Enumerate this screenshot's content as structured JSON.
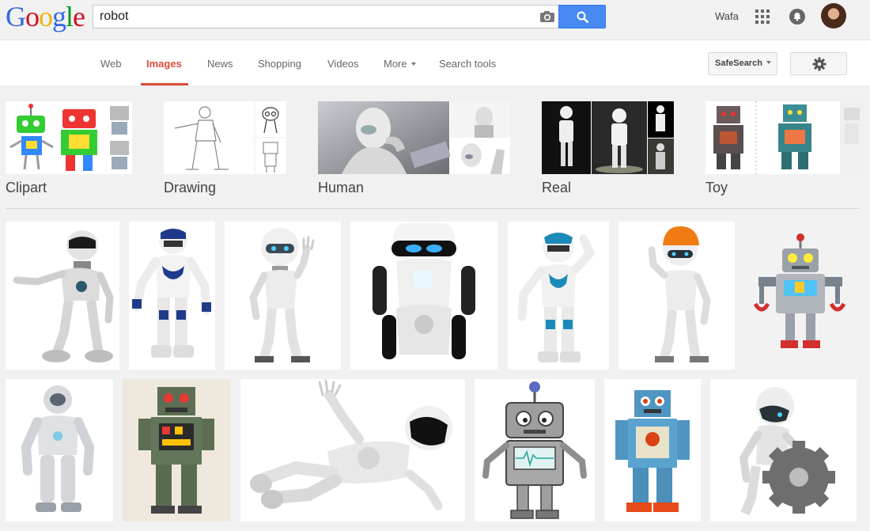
{
  "logo": {
    "letters": [
      "G",
      "o",
      "o",
      "g",
      "l",
      "e"
    ],
    "colors": [
      "#3369e8",
      "#d50f25",
      "#eeb211",
      "#3369e8",
      "#009925",
      "#d50f25"
    ]
  },
  "search": {
    "query": "robot",
    "button_icon": "search-icon",
    "camera_icon": "camera-icon"
  },
  "account": {
    "name": "Wafa",
    "apps_icon": "apps-grid-icon",
    "notifications_icon": "bell-icon"
  },
  "nav": {
    "tabs": [
      {
        "label": "Web",
        "active": false
      },
      {
        "label": "Images",
        "active": true
      },
      {
        "label": "News",
        "active": false
      },
      {
        "label": "Shopping",
        "active": false
      },
      {
        "label": "Videos",
        "active": false
      },
      {
        "label": "More",
        "active": false
      },
      {
        "label": "Search tools",
        "active": false
      }
    ],
    "safesearch_label": "SafeSearch",
    "settings_icon": "gear-icon"
  },
  "related": [
    {
      "label": "Clipart"
    },
    {
      "label": "Drawing"
    },
    {
      "label": "Human"
    },
    {
      "label": "Real"
    },
    {
      "label": "Toy"
    }
  ],
  "colors": {
    "accent": "#dd4b39",
    "search_button": "#4889f1"
  },
  "results": [
    {
      "subject": "white robot with black visor",
      "style": "white"
    },
    {
      "subject": "white and blue humanoid robot",
      "style": "blue"
    },
    {
      "subject": "white robot waving",
      "style": "white"
    },
    {
      "subject": "white wheeled robot with black visor",
      "style": "wheeled"
    },
    {
      "subject": "white and blue humanoid robot posing",
      "style": "blue"
    },
    {
      "subject": "white robot with orange helmet",
      "style": "orange"
    },
    {
      "subject": "grey cartoon robot with red claws",
      "style": "cartoon"
    },
    {
      "subject": "silver humanoid robot",
      "style": "silver"
    },
    {
      "subject": "green vintage toy robot",
      "style": "toy-green"
    },
    {
      "subject": "white robot lying down",
      "style": "lying"
    },
    {
      "subject": "grey cartoon robot with antenna",
      "style": "cartoon2"
    },
    {
      "subject": "blue vintage toy robot",
      "style": "toy-blue"
    },
    {
      "subject": "white robot with gear",
      "style": "gear"
    }
  ]
}
